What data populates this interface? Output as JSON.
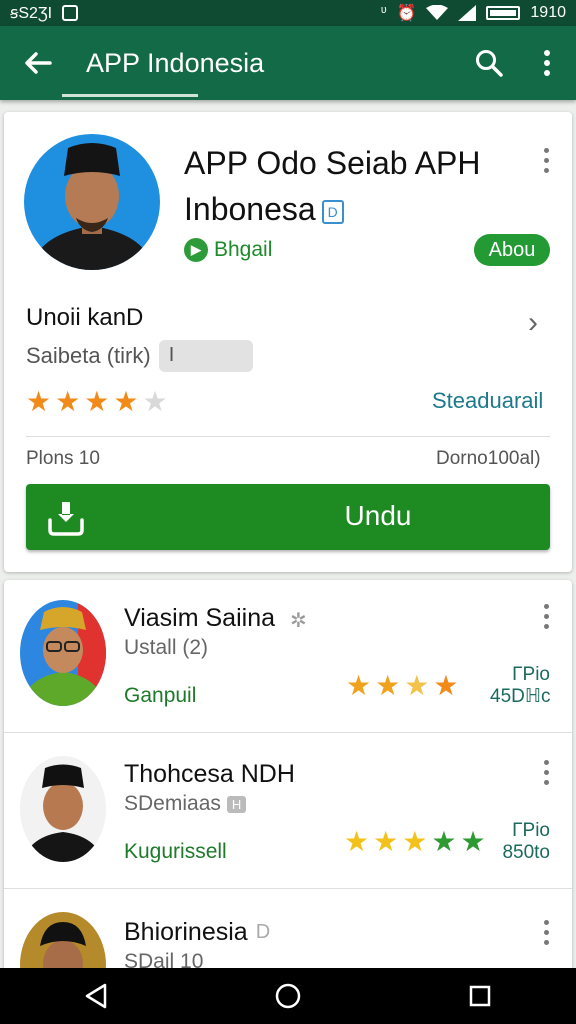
{
  "status_bar": {
    "left_text": "ꞩS2ƷI",
    "time": "1910"
  },
  "app_bar": {
    "title": "APP Indonesia",
    "back_icon": "arrow-left-icon",
    "search_icon": "search-icon",
    "overflow_icon": "more-vert-icon"
  },
  "featured": {
    "title_line1": "APP Odo Seiab APH",
    "title_line2": "Inbonesa",
    "title_badge": "D",
    "publisher": "Bhgail",
    "chip": "Abou",
    "section_heading": "Unoii kanD",
    "sub_label": "Saibeta (tirk)",
    "sub_pill": "I",
    "rating": 3.5,
    "rating_max": 5,
    "link_text": "Steaduarail",
    "meta_left": "Plons 10",
    "meta_right": "Dorno100al)",
    "install_label": "Undu",
    "colors": {
      "accent": "#1e8a22",
      "star_on": "#f28a1a",
      "star_off": "#d9d9d9"
    }
  },
  "list": [
    {
      "name": "Viasim Saiina",
      "sub": "Ustall (2)",
      "category": "Ganpuil",
      "price_line1": "ΓPio",
      "price_line2": "45Dℍc",
      "rating": 4
    },
    {
      "name": "Thohcesa NDH",
      "sub": "SDemiaas",
      "badge": "H",
      "category": "Kugurissell",
      "price_line1": "ΓPio",
      "price_line2": "850to",
      "rating": 5
    },
    {
      "name": "Bhiorinesia",
      "badge": "D",
      "sub": "SDail 10",
      "category": "",
      "price_line1": "",
      "price_line2": ""
    }
  ],
  "nav": {
    "back": "nav-back-icon",
    "home": "nav-home-icon",
    "recents": "nav-recents-icon"
  }
}
